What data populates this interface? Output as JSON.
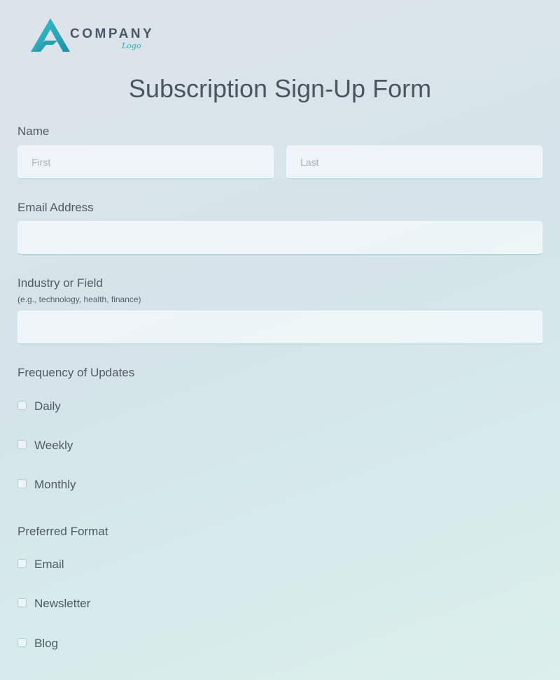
{
  "logo": {
    "company": "COMPANY",
    "sub": "Logo",
    "accent_color": "#2aa8b8",
    "icon": "triangle-logo-icon"
  },
  "form": {
    "title": "Subscription Sign-Up Form",
    "name": {
      "label": "Name",
      "first_placeholder": "First",
      "last_placeholder": "Last"
    },
    "email": {
      "label": "Email Address",
      "value": ""
    },
    "industry": {
      "label": "Industry or Field",
      "hint": "(e.g., technology, health, finance)",
      "value": ""
    },
    "frequency": {
      "label": "Frequency of Updates",
      "options": [
        "Daily",
        "Weekly",
        "Monthly"
      ]
    },
    "format": {
      "label": "Preferred Format",
      "options": [
        "Email",
        "Newsletter",
        "Blog"
      ]
    }
  },
  "colors": {
    "field_border_accent": "#a9d7dc",
    "text": "#4f5a64"
  }
}
